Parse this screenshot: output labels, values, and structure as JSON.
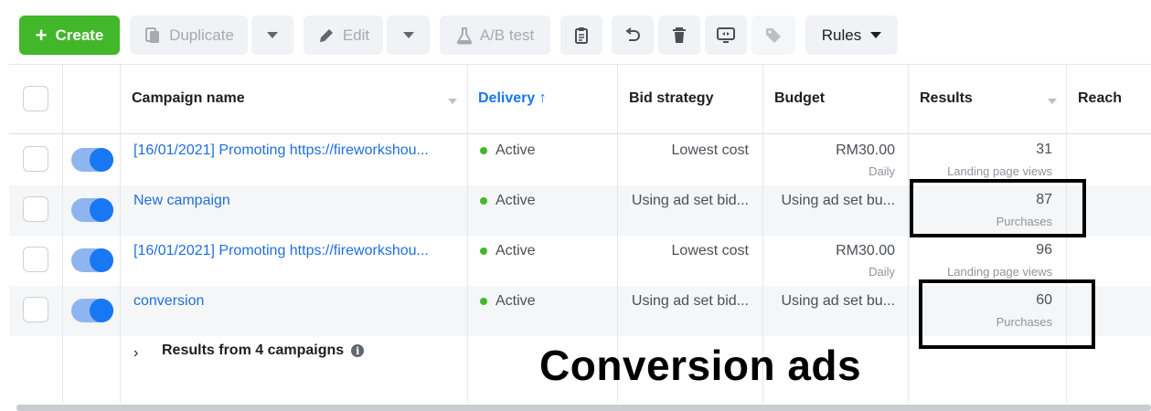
{
  "toolbar": {
    "create_label": "Create",
    "duplicate_label": "Duplicate",
    "edit_label": "Edit",
    "ab_test_label": "A/B test",
    "rules_label": "Rules"
  },
  "table": {
    "headers": {
      "campaign_name": "Campaign name",
      "delivery": "Delivery ↑",
      "bid_strategy": "Bid strategy",
      "budget": "Budget",
      "results": "Results",
      "reach": "Reach"
    },
    "rows": [
      {
        "name": "[16/01/2021] Promoting https://fireworkshou...",
        "delivery": "Active",
        "bid_strategy": "Lowest cost",
        "budget": "RM30.00",
        "budget_period": "Daily",
        "result": "31",
        "result_type": "Landing page views"
      },
      {
        "name": "New campaign",
        "delivery": "Active",
        "bid_strategy": "Using ad set bid...",
        "budget": "Using ad set bu...",
        "budget_period": "",
        "result": "87",
        "result_type": "Purchases"
      },
      {
        "name": "[16/01/2021] Promoting https://fireworkshou...",
        "delivery": "Active",
        "bid_strategy": "Lowest cost",
        "budget": "RM30.00",
        "budget_period": "Daily",
        "result": "96",
        "result_type": "Landing page views"
      },
      {
        "name": "conversion",
        "delivery": "Active",
        "bid_strategy": "Using ad set bid...",
        "budget": "Using ad set bu...",
        "budget_period": "",
        "result": "60",
        "result_type": "Purchases"
      }
    ],
    "footer_label": "Results from 4 campaigns"
  },
  "overlay_caption": "Conversion ads",
  "colors": {
    "create_green": "#42b72a",
    "link_blue": "#216fdb",
    "toggle_on": "#1877f2",
    "active_dot": "#42b72a"
  }
}
